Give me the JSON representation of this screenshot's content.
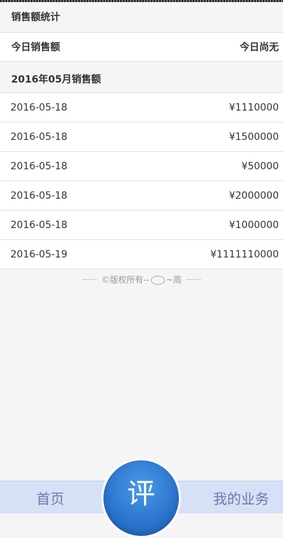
{
  "summary": {
    "title": "销售额统计",
    "today_label": "今日销售额",
    "today_value": "今日尚无"
  },
  "monthly": {
    "title": "2016年05月销售额",
    "rows": [
      {
        "date": "2016-05-18",
        "amount": "¥1110000"
      },
      {
        "date": "2016-05-18",
        "amount": "¥1500000"
      },
      {
        "date": "2016-05-18",
        "amount": "¥50000"
      },
      {
        "date": "2016-05-18",
        "amount": "¥2000000"
      },
      {
        "date": "2016-05-18",
        "amount": "¥1000000"
      },
      {
        "date": "2016-05-19",
        "amount": "¥1111110000"
      }
    ]
  },
  "footer": {
    "copyright_left": "©版权所有--",
    "copyright_right": "~周"
  },
  "nav": {
    "home": "首页",
    "center": "评",
    "business": "我的业务"
  }
}
